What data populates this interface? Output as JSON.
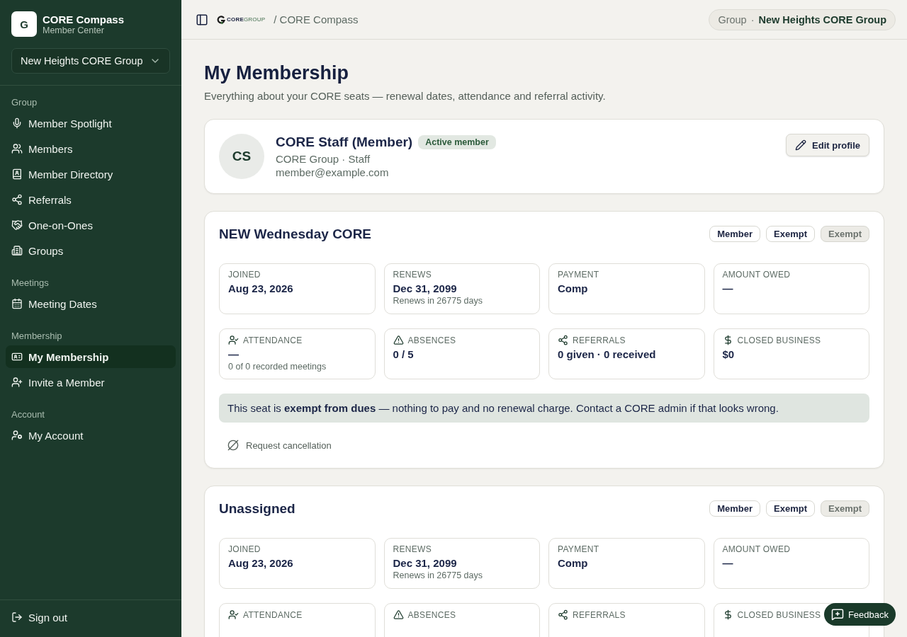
{
  "brand": {
    "mark": "G",
    "name": "CORE Compass",
    "subtitle": "Member Center"
  },
  "group_select": {
    "value": "New Heights CORE Group"
  },
  "sidebar": {
    "sections": [
      {
        "title": "Group",
        "items": [
          {
            "label": "Member Spotlight",
            "selected": false
          },
          {
            "label": "Members",
            "selected": false
          },
          {
            "label": "Member Directory",
            "selected": false
          },
          {
            "label": "Referrals",
            "selected": false
          },
          {
            "label": "One-on-Ones",
            "selected": false
          },
          {
            "label": "Groups",
            "selected": false
          }
        ]
      },
      {
        "title": "Meetings",
        "items": [
          {
            "label": "Meeting Dates",
            "selected": false
          }
        ]
      },
      {
        "title": "Membership",
        "items": [
          {
            "label": "My Membership",
            "selected": true
          },
          {
            "label": "Invite a Member",
            "selected": false
          }
        ]
      },
      {
        "title": "Account",
        "items": [
          {
            "label": "My Account",
            "selected": false
          }
        ]
      }
    ],
    "sign_out": "Sign out"
  },
  "header": {
    "logo": {
      "bold": "CORE",
      "light": "GROUP"
    },
    "breadcrumb": "/ CORE Compass",
    "group_chip": {
      "label": "Group",
      "separator": "·",
      "value": "New Heights CORE Group"
    }
  },
  "page": {
    "title": "My Membership",
    "subtitle": "Everything about your CORE seats — renewal dates, attendance and referral activity."
  },
  "profile": {
    "initials": "CS",
    "name": "CORE Staff (Member)",
    "badge": "Active member",
    "org": "CORE Group · Staff",
    "email": "member@example.com",
    "edit_button": "Edit profile"
  },
  "seats": [
    {
      "title": "NEW Wednesday CORE",
      "badges": [
        {
          "label": "Member",
          "kind": "outline"
        },
        {
          "label": "Exempt",
          "kind": "outline"
        },
        {
          "label": "Exempt",
          "kind": "muted"
        }
      ],
      "stats": [
        {
          "label": "JOINED",
          "value": "Aug 23, 2026"
        },
        {
          "label": "RENEWS",
          "value": "Dec 31, 2099",
          "note": "Renews in 26775 days"
        },
        {
          "label": "PAYMENT",
          "value": "Comp"
        },
        {
          "label": "AMOUNT OWED",
          "value": "—"
        },
        {
          "label": "ATTENDANCE",
          "value": "—",
          "note": "0 of 0 recorded meetings"
        },
        {
          "label": "ABSENCES",
          "value": "0 / 5"
        },
        {
          "label": "REFERRALS",
          "value": "0 given · 0 received"
        },
        {
          "label": "CLOSED BUSINESS",
          "value": "$0"
        }
      ],
      "notice": "This seat is **exempt from dues** — nothing to pay and no renewal charge. Contact a CORE admin if that looks wrong.",
      "cancel_link": "Request cancellation"
    },
    {
      "title": "Unassigned",
      "badges": [
        {
          "label": "Member",
          "kind": "outline"
        },
        {
          "label": "Exempt",
          "kind": "outline"
        },
        {
          "label": "Exempt",
          "kind": "muted"
        }
      ],
      "stats": [
        {
          "label": "JOINED",
          "value": "Aug 23, 2026"
        },
        {
          "label": "RENEWS",
          "value": "Dec 31, 2099",
          "note": "Renews in 26775 days"
        },
        {
          "label": "PAYMENT",
          "value": "Comp"
        },
        {
          "label": "AMOUNT OWED",
          "value": "—"
        },
        {
          "label": "ATTENDANCE"
        },
        {
          "label": "ABSENCES"
        },
        {
          "label": "REFERRALS"
        },
        {
          "label": "CLOSED BUSINESS"
        }
      ]
    }
  ],
  "feedback_button": "Feedback"
}
